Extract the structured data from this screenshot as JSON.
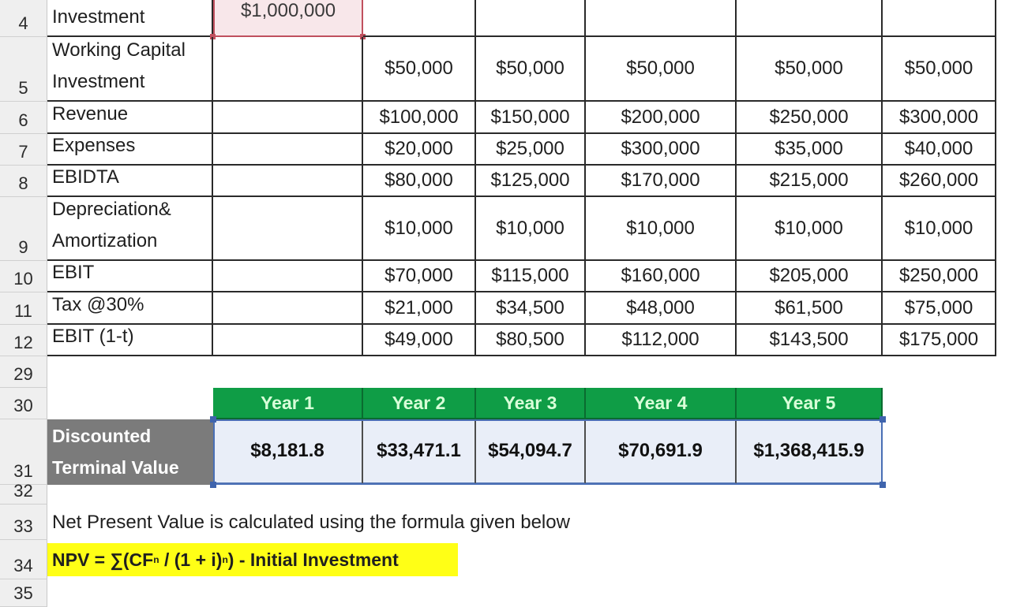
{
  "row_headers": [
    "4",
    "5",
    "6",
    "7",
    "8",
    "9",
    "10",
    "11",
    "12",
    "29",
    "30",
    "31",
    "32",
    "33",
    "34",
    "35"
  ],
  "top_table": {
    "rows": [
      {
        "row": "4",
        "label": [
          "Investment"
        ],
        "initial": "$1,000,000",
        "values": [
          "",
          "",
          "",
          "",
          ""
        ]
      },
      {
        "row": "5",
        "label": [
          "Working Capital",
          "Investment"
        ],
        "initial": "",
        "values": [
          "$50,000",
          "$50,000",
          "$50,000",
          "$50,000",
          "$50,000"
        ]
      },
      {
        "row": "6",
        "label": [
          "Revenue"
        ],
        "initial": "",
        "values": [
          "$100,000",
          "$150,000",
          "$200,000",
          "$250,000",
          "$300,000"
        ]
      },
      {
        "row": "7",
        "label": [
          "Expenses"
        ],
        "initial": "",
        "values": [
          "$20,000",
          "$25,000",
          "$300,000",
          "$35,000",
          "$40,000"
        ]
      },
      {
        "row": "8",
        "label": [
          "EBIDTA"
        ],
        "initial": "",
        "values": [
          "$80,000",
          "$125,000",
          "$170,000",
          "$215,000",
          "$260,000"
        ]
      },
      {
        "row": "9",
        "label": [
          "Depreciation&",
          "Amortization"
        ],
        "initial": "",
        "values": [
          "$10,000",
          "$10,000",
          "$10,000",
          "$10,000",
          "$10,000"
        ]
      },
      {
        "row": "10",
        "label": [
          "EBIT"
        ],
        "initial": "",
        "values": [
          "$70,000",
          "$115,000",
          "$160,000",
          "$205,000",
          "$250,000"
        ]
      },
      {
        "row": "11",
        "label": [
          "Tax @30%"
        ],
        "initial": "",
        "values": [
          "$21,000",
          "$34,500",
          "$48,000",
          "$61,500",
          "$75,000"
        ]
      },
      {
        "row": "12",
        "label": [
          "EBIT (1-t)"
        ],
        "initial": "",
        "values": [
          "$49,000",
          "$80,500",
          "$112,000",
          "$143,500",
          "$175,000"
        ]
      }
    ]
  },
  "dtv_table": {
    "headers": [
      "Year 1",
      "Year 2",
      "Year 3",
      "Year 4",
      "Year 5"
    ],
    "label": [
      "Discounted",
      "Terminal Value"
    ],
    "values": [
      "$8,181.8",
      "$33,471.1",
      "$54,094.7",
      "$70,691.9",
      "$1,368,415.9"
    ]
  },
  "note": "Net Present Value is calculated using the formula given below",
  "formula": {
    "prefix": "NPV = ∑(CF",
    "sub": "n",
    "middle": " / (1 + i)",
    "sup": "n",
    "suffix": ") - Initial Investment"
  },
  "colors": {
    "header_green": "#0f9d46",
    "label_gray": "#7b7b7b",
    "highlight_yellow": "#ffff16",
    "selection_blue": "#4a6fb5",
    "initial_investment_red": "#c0505e"
  }
}
